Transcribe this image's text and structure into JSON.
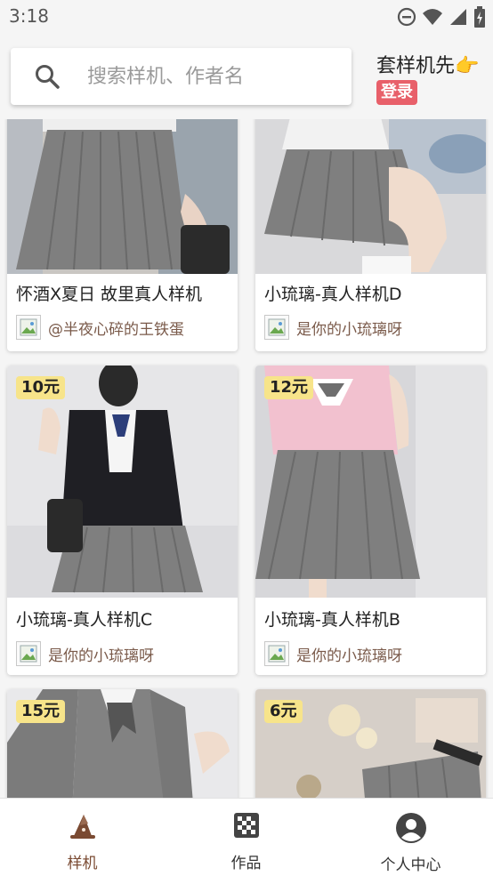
{
  "status_bar": {
    "time": "3:18",
    "icons": [
      "dnd-icon",
      "wifi-icon",
      "signal-icon",
      "battery-charging-icon"
    ]
  },
  "search": {
    "placeholder": "搜索样机、作者名",
    "icon": "search-icon"
  },
  "promo": {
    "text": "套样机先👉",
    "login_label": "登录",
    "login_color": "#e8606a"
  },
  "cards": [
    {
      "price": "",
      "title": "怀酒X夏日 故里真人样机",
      "author": "@半夜心碎的王铁蛋"
    },
    {
      "price": "",
      "title": "小琉璃-真人样机D",
      "author": "是你的小琉璃呀"
    },
    {
      "price": "10元",
      "title": "小琉璃-真人样机C",
      "author": "是你的小琉璃呀"
    },
    {
      "price": "12元",
      "title": "小琉璃-真人样机B",
      "author": "是你的小琉璃呀"
    },
    {
      "price": "15元",
      "title": "",
      "author": ""
    },
    {
      "price": "6元",
      "title": "",
      "author": ""
    }
  ],
  "nav": {
    "items": [
      {
        "label": "样机",
        "icon": "wizard-hat-icon",
        "active": true
      },
      {
        "label": "作品",
        "icon": "checker-grid-icon",
        "active": false
      },
      {
        "label": "个人中心",
        "icon": "user-circle-icon",
        "active": false
      }
    ],
    "active_color": "#7a4a32"
  },
  "colors": {
    "price_badge": "#f7e48a",
    "author_text": "#7a5a4a",
    "skirt_gray": "#7f7f7f"
  }
}
